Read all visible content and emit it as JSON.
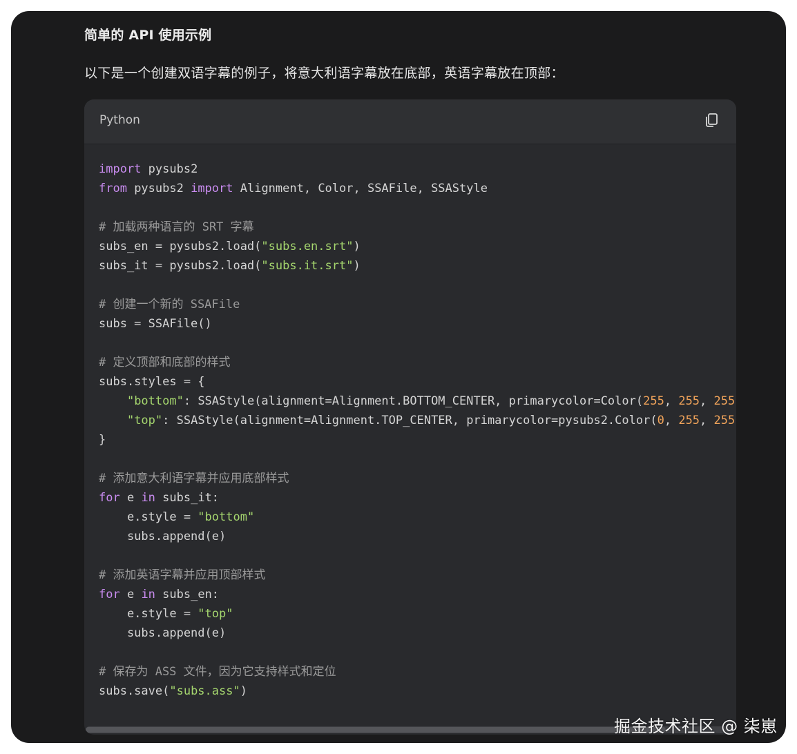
{
  "section": {
    "heading": "简单的 API 使用示例",
    "intro": "以下是一个创建双语字幕的例子，将意大利语字幕放在底部，英语字幕放在顶部："
  },
  "code_block": {
    "language": "Python",
    "copy_icon": "copy-icon",
    "lines": [
      [
        {
          "t": "import",
          "c": "kw"
        },
        {
          "t": " pysubs2"
        }
      ],
      [
        {
          "t": "from",
          "c": "kw"
        },
        {
          "t": " pysubs2 "
        },
        {
          "t": "import",
          "c": "kw"
        },
        {
          "t": " Alignment, Color, SSAFile, SSAStyle"
        }
      ],
      [],
      [
        {
          "t": "# 加载两种语言的 SRT 字幕",
          "c": "cm"
        }
      ],
      [
        {
          "t": "subs_en = pysubs2.load("
        },
        {
          "t": "\"subs.en.srt\"",
          "c": "str"
        },
        {
          "t": ")"
        }
      ],
      [
        {
          "t": "subs_it = pysubs2.load("
        },
        {
          "t": "\"subs.it.srt\"",
          "c": "str"
        },
        {
          "t": ")"
        }
      ],
      [],
      [
        {
          "t": "# 创建一个新的 SSAFile",
          "c": "cm"
        }
      ],
      [
        {
          "t": "subs = SSAFile()"
        }
      ],
      [],
      [
        {
          "t": "# 定义顶部和底部的样式",
          "c": "cm"
        }
      ],
      [
        {
          "t": "subs.styles = {"
        }
      ],
      [
        {
          "t": "    "
        },
        {
          "t": "\"bottom\"",
          "c": "str"
        },
        {
          "t": ": SSAStyle(alignment=Alignment.BOTTOM_CENTER, primarycolor=Color("
        },
        {
          "t": "255",
          "c": "num"
        },
        {
          "t": ", "
        },
        {
          "t": "255",
          "c": "num"
        },
        {
          "t": ", "
        },
        {
          "t": "255",
          "c": "num"
        },
        {
          "t": ")),"
        }
      ],
      [
        {
          "t": "    "
        },
        {
          "t": "\"top\"",
          "c": "str"
        },
        {
          "t": ": SSAStyle(alignment=Alignment.TOP_CENTER, primarycolor=pysubs2.Color("
        },
        {
          "t": "0",
          "c": "num"
        },
        {
          "t": ", "
        },
        {
          "t": "255",
          "c": "num"
        },
        {
          "t": ", "
        },
        {
          "t": "255",
          "c": "num"
        },
        {
          "t": ")),"
        }
      ],
      [
        {
          "t": "}"
        }
      ],
      [],
      [
        {
          "t": "# 添加意大利语字幕并应用底部样式",
          "c": "cm"
        }
      ],
      [
        {
          "t": "for",
          "c": "kw"
        },
        {
          "t": " e "
        },
        {
          "t": "in",
          "c": "kw"
        },
        {
          "t": " subs_it:"
        }
      ],
      [
        {
          "t": "    e.style = "
        },
        {
          "t": "\"bottom\"",
          "c": "str"
        }
      ],
      [
        {
          "t": "    subs.append(e)"
        }
      ],
      [],
      [
        {
          "t": "# 添加英语字幕并应用顶部样式",
          "c": "cm"
        }
      ],
      [
        {
          "t": "for",
          "c": "kw"
        },
        {
          "t": " e "
        },
        {
          "t": "in",
          "c": "kw"
        },
        {
          "t": " subs_en:"
        }
      ],
      [
        {
          "t": "    e.style = "
        },
        {
          "t": "\"top\"",
          "c": "str"
        }
      ],
      [
        {
          "t": "    subs.append(e)"
        }
      ],
      [],
      [
        {
          "t": "# 保存为 ASS 文件，因为它支持样式和定位",
          "c": "cm"
        }
      ],
      [
        {
          "t": "subs.save("
        },
        {
          "t": "\"subs.ass\"",
          "c": "str"
        },
        {
          "t": ")"
        }
      ]
    ]
  },
  "watermark": "掘金技术社区 @ 柒崽",
  "colors": {
    "background": "#1b1b1c",
    "code_bg": "#292a2d",
    "keyword": "#c98cf0",
    "string": "#a5d66e",
    "number": "#f0a35a",
    "comment": "#9a9a9a"
  }
}
